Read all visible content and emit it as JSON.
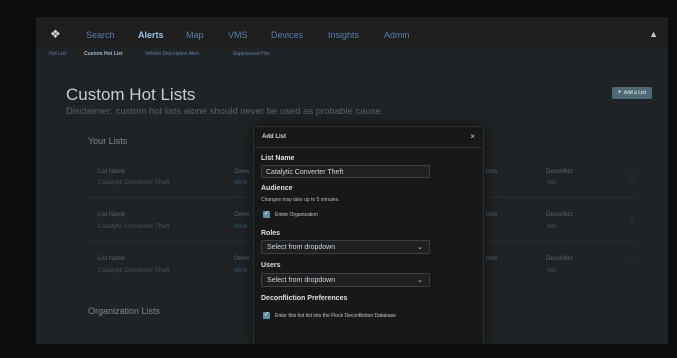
{
  "nav": {
    "items": [
      {
        "label": "Search",
        "active": false
      },
      {
        "label": "Alerts",
        "active": true
      },
      {
        "label": "Map",
        "active": false
      },
      {
        "label": "VMS",
        "active": false
      },
      {
        "label": "Devices",
        "active": false
      },
      {
        "label": "Insights",
        "active": false
      },
      {
        "label": "Admin",
        "active": false
      }
    ]
  },
  "subnav": {
    "items": [
      {
        "label": "Hot List",
        "active": false
      },
      {
        "label": "Custom Hot List",
        "active": true
      },
      {
        "label": "Vehicle Description Alert",
        "active": false
      },
      {
        "label": "Suppressed Hits",
        "active": false
      }
    ]
  },
  "page": {
    "title": "Custom Hot Lists",
    "disclaimer": "Disclaimer: custom hot lists alone should never be used as probable cause.",
    "add_list_label": "Add a List"
  },
  "your_lists": {
    "title": "Your Lists",
    "rows": [
      {
        "list_name_header": "List Name",
        "list_name": "Catalytic Converter Theft",
        "owner_header": "Owne",
        "owner": "Wrie",
        "alerts_header": "lerts",
        "deconflict_header": "Deconflict",
        "deconflict": "Yes"
      },
      {
        "list_name_header": "List Name",
        "list_name": "Catalytic Converter Theft",
        "owner_header": "Owne",
        "owner": "Wrie",
        "alerts_header": "lerts",
        "deconflict_header": "Deconflict",
        "deconflict": "Yes"
      },
      {
        "list_name_header": "List Name",
        "list_name": "Catalytic Converter Theft",
        "owner_header": "Owne",
        "owner": "Wrie",
        "alerts_header": "lerts",
        "deconflict_header": "Deconflict",
        "deconflict": "Yes"
      }
    ]
  },
  "organization_lists": {
    "title": "Organization Lists"
  },
  "modal": {
    "title": "Add List",
    "list_name_label": "List Name",
    "list_name_value": "Catalytic Converter Theft",
    "audience_label": "Audience",
    "audience_help": "Changes may take up to 5 minutes.",
    "entire_org_label": "Entire Organization",
    "roles_label": "Roles",
    "roles_value": "Select from dropdown",
    "users_label": "Users",
    "users_value": "Select from dropdown",
    "deconfliction_label": "Deconfliction Preferences",
    "deconfliction_checkbox_label": "Enter this hot list into the Flock Deconfliction Database"
  }
}
